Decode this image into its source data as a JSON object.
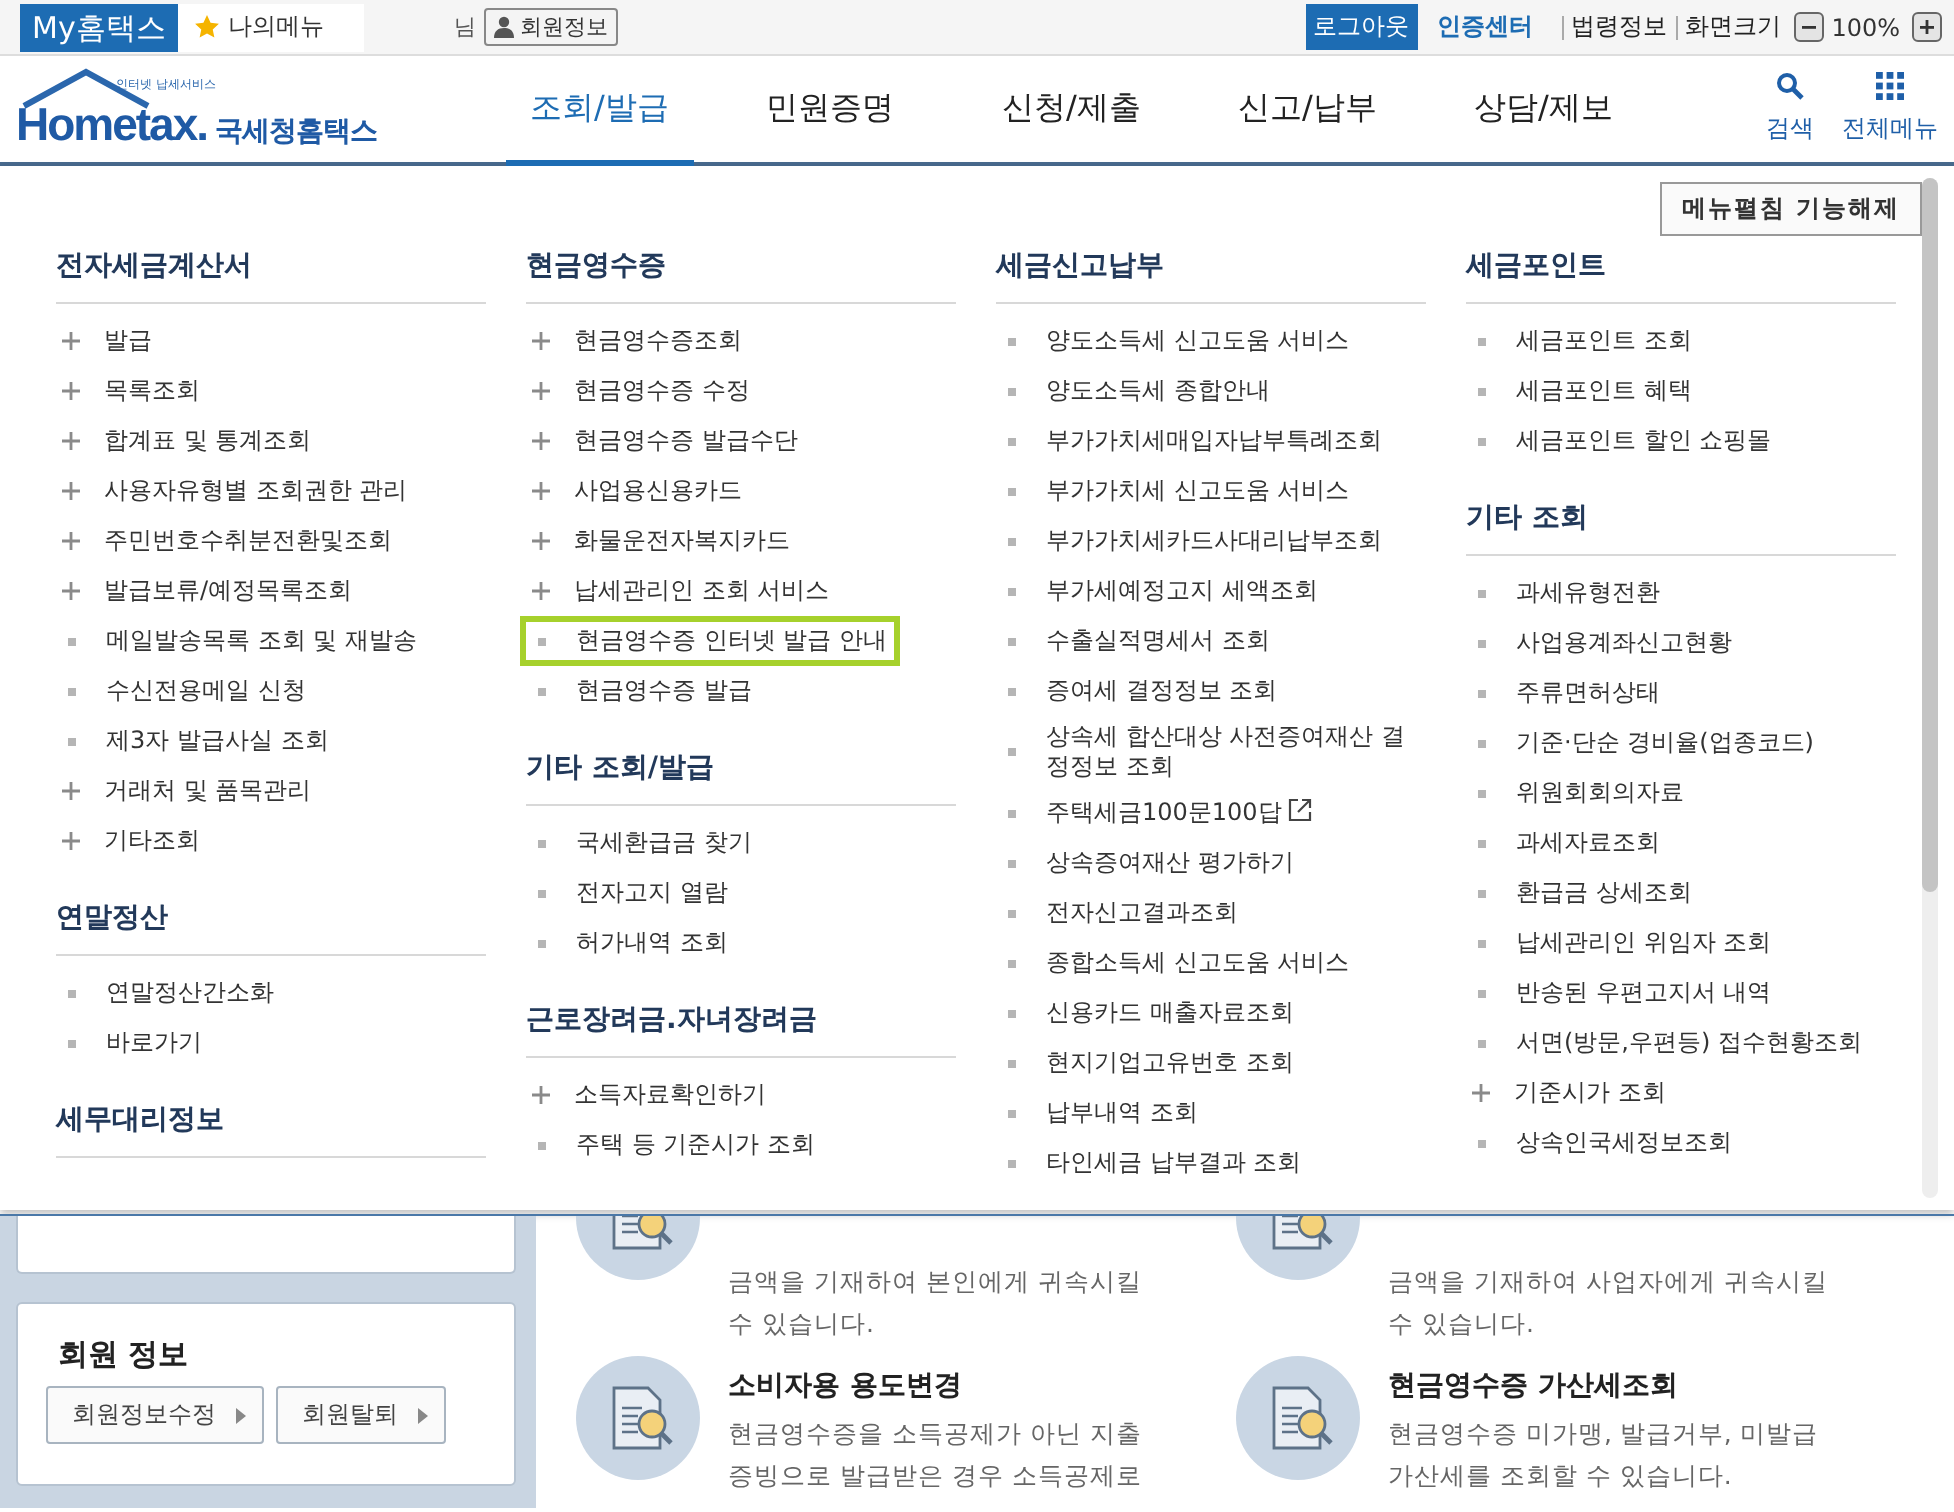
{
  "top_bar": {
    "my_tab": "My홈택스",
    "my_menu": "나의메뉴",
    "user_suffix": "님",
    "member_button": "회원정보",
    "logout": "로그아웃",
    "cert_center": "인증센터",
    "law_info": "법령정보",
    "zoom_label": "화면크기",
    "zoom_value": "100%"
  },
  "header": {
    "logo_tagline": "인터넷 납세서비스",
    "logo_text": "Hometax.",
    "logo_name": "국세청홈택스",
    "search": "검색",
    "all_menu": "전체메뉴",
    "nav": [
      {
        "label": "조회/발급",
        "selected": true
      },
      {
        "label": "민원증명",
        "selected": false
      },
      {
        "label": "신청/제출",
        "selected": false
      },
      {
        "label": "신고/납부",
        "selected": false
      },
      {
        "label": "상담/제보",
        "selected": false
      }
    ]
  },
  "mega_menu": {
    "collapse_button": "메뉴펼침 기능해제",
    "columns": [
      {
        "sections": [
          {
            "title": "전자세금계산서",
            "items": [
              {
                "label": "발급",
                "kind": "sub",
                "highlighted": false
              },
              {
                "label": "목록조회",
                "kind": "sub",
                "highlighted": false
              },
              {
                "label": "합계표 및 통계조회",
                "kind": "sub",
                "highlighted": false
              },
              {
                "label": "사용자유형별 조회권한 관리",
                "kind": "sub",
                "highlighted": false
              },
              {
                "label": "주민번호수취분전환및조회",
                "kind": "sub",
                "highlighted": false
              },
              {
                "label": "발급보류/예정목록조회",
                "kind": "sub",
                "highlighted": false
              },
              {
                "label": "메일발송목록 조회 및 재발송",
                "kind": "link",
                "highlighted": false
              },
              {
                "label": "수신전용메일 신청",
                "kind": "link",
                "highlighted": false
              },
              {
                "label": "제3자 발급사실 조회",
                "kind": "link",
                "highlighted": false
              },
              {
                "label": "거래처 및 품목관리",
                "kind": "sub",
                "highlighted": false
              },
              {
                "label": "기타조회",
                "kind": "sub",
                "highlighted": false
              }
            ]
          },
          {
            "title": "연말정산",
            "items": [
              {
                "label": "연말정산간소화",
                "kind": "link",
                "highlighted": false
              },
              {
                "label": "바로가기",
                "kind": "link",
                "highlighted": false
              }
            ]
          },
          {
            "title": "세무대리정보"
          }
        ]
      },
      {
        "sections": [
          {
            "title": "현금영수증",
            "items": [
              {
                "label": "현금영수증조회",
                "kind": "sub",
                "highlighted": false
              },
              {
                "label": "현금영수증 수정",
                "kind": "sub",
                "highlighted": false
              },
              {
                "label": "현금영수증 발급수단",
                "kind": "sub",
                "highlighted": false
              },
              {
                "label": "사업용신용카드",
                "kind": "sub",
                "highlighted": false
              },
              {
                "label": "화물운전자복지카드",
                "kind": "sub",
                "highlighted": false
              },
              {
                "label": "납세관리인 조회 서비스",
                "kind": "sub",
                "highlighted": false
              },
              {
                "label": "현금영수증 인터넷 발급 안내",
                "kind": "link",
                "highlighted": true
              },
              {
                "label": "현금영수증 발급",
                "kind": "link",
                "highlighted": false
              }
            ]
          },
          {
            "title": "기타 조회/발급",
            "items": [
              {
                "label": "국세환급금 찾기",
                "kind": "link",
                "highlighted": false
              },
              {
                "label": "전자고지 열람",
                "kind": "link",
                "highlighted": false
              },
              {
                "label": "허가내역 조회",
                "kind": "link",
                "highlighted": false
              }
            ]
          },
          {
            "title": "근로장려금.자녀장려금",
            "items": [
              {
                "label": "소득자료확인하기",
                "kind": "sub",
                "highlighted": false
              },
              {
                "label": "주택 등 기준시가 조회",
                "kind": "link",
                "highlighted": false
              }
            ]
          }
        ]
      },
      {
        "sections": [
          {
            "title": "세금신고납부",
            "items": [
              {
                "label": "양도소득세 신고도움 서비스",
                "kind": "link",
                "highlighted": false
              },
              {
                "label": "양도소득세 종합안내",
                "kind": "link",
                "highlighted": false
              },
              {
                "label": "부가가치세매입자납부특례조회",
                "kind": "link",
                "highlighted": false
              },
              {
                "label": "부가가치세 신고도움 서비스",
                "kind": "link",
                "highlighted": false
              },
              {
                "label": "부가가치세카드사대리납부조회",
                "kind": "link",
                "highlighted": false
              },
              {
                "label": "부가세예정고지 세액조회",
                "kind": "link",
                "highlighted": false
              },
              {
                "label": "수출실적명세서 조회",
                "kind": "link",
                "highlighted": false
              },
              {
                "label": "증여세 결정정보 조회",
                "kind": "link",
                "highlighted": false
              },
              {
                "label": "상속세 합산대상 사전증여재산 결정정보 조회",
                "kind": "link",
                "highlighted": false
              },
              {
                "label": "주택세금100문100답",
                "kind": "external",
                "highlighted": false
              },
              {
                "label": "상속증여재산 평가하기",
                "kind": "link",
                "highlighted": false
              },
              {
                "label": "전자신고결과조회",
                "kind": "link",
                "highlighted": false
              },
              {
                "label": "종합소득세 신고도움 서비스",
                "kind": "link",
                "highlighted": false
              },
              {
                "label": "신용카드 매출자료조회",
                "kind": "link",
                "highlighted": false
              },
              {
                "label": "현지기업고유번호 조회",
                "kind": "link",
                "highlighted": false
              },
              {
                "label": "납부내역 조회",
                "kind": "link",
                "highlighted": false
              },
              {
                "label": "타인세금 납부결과 조회",
                "kind": "link",
                "highlighted": false
              }
            ]
          }
        ]
      },
      {
        "sections": [
          {
            "title": "세금포인트",
            "items": [
              {
                "label": "세금포인트 조회",
                "kind": "link",
                "highlighted": false
              },
              {
                "label": "세금포인트 혜택",
                "kind": "link",
                "highlighted": false
              },
              {
                "label": "세금포인트 할인 쇼핑몰",
                "kind": "link",
                "highlighted": false
              }
            ]
          },
          {
            "title": "기타 조회",
            "items": [
              {
                "label": "과세유형전환",
                "kind": "link",
                "highlighted": false
              },
              {
                "label": "사업용계좌신고현황",
                "kind": "link",
                "highlighted": false
              },
              {
                "label": "주류면허상태",
                "kind": "link",
                "highlighted": false
              },
              {
                "label": "기준·단순 경비율(업종코드)",
                "kind": "link",
                "highlighted": false
              },
              {
                "label": "위원회회의자료",
                "kind": "link",
                "highlighted": false
              },
              {
                "label": "과세자료조회",
                "kind": "link",
                "highlighted": false
              },
              {
                "label": "환급금 상세조회",
                "kind": "link",
                "highlighted": false
              },
              {
                "label": "납세관리인 위임자 조회",
                "kind": "link",
                "highlighted": false
              },
              {
                "label": "반송된 우편고지서 내역",
                "kind": "link",
                "highlighted": false
              },
              {
                "label": "서면(방문,우편등) 접수현황조회",
                "kind": "link",
                "highlighted": false
              },
              {
                "label": "기준시가 조회",
                "kind": "sub",
                "highlighted": false
              },
              {
                "label": "상속인국세정보조회",
                "kind": "link",
                "highlighted": false
              }
            ]
          }
        ]
      }
    ]
  },
  "sidebar": {
    "member_title": "회원 정보",
    "buttons": [
      "회원정보수정",
      "회원탈퇴"
    ]
  },
  "services": [
    {
      "description": "금액을 기재하여 본인에게 귀속시킬 수 있습니다."
    },
    {
      "description": "금액을 기재하여 사업자에게 귀속시킬 수 있습니다."
    },
    {
      "title": "소비자용 용도변경",
      "description": "현금영수증을 소득공제가 아닌 지출 증빙으로 발급받은 경우 소득공제로"
    },
    {
      "title": "현금영수증 가산세조회",
      "description": "현금영수증 미가맹, 발급거부, 미발급 가산세를 조회할 수 있습니다."
    }
  ]
}
